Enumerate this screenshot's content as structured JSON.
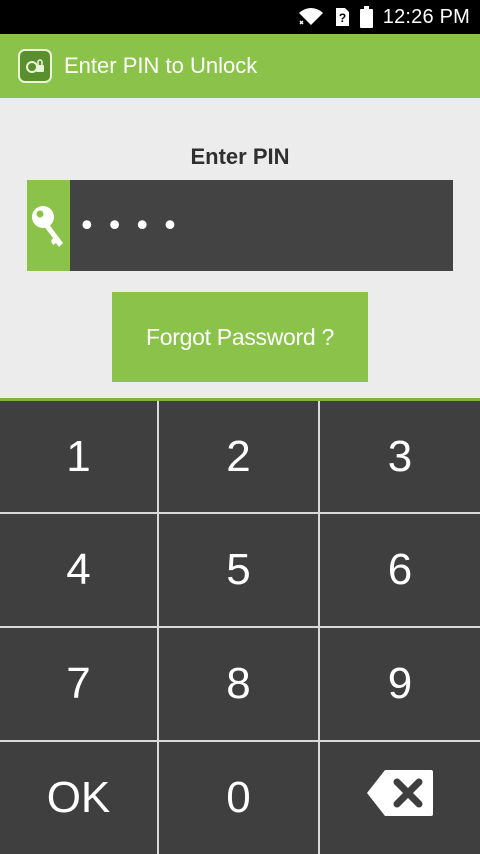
{
  "status_bar": {
    "time": "12:26 PM",
    "icons": [
      "wifi-icon",
      "sim-unknown-icon",
      "battery-icon"
    ],
    "sim_glyph": "?"
  },
  "app_bar": {
    "title": "Enter PIN to Unlock",
    "logo_icon": "app-lock-icon"
  },
  "pin": {
    "label": "Enter PIN",
    "value": "••••",
    "key_icon": "key-icon"
  },
  "forgot_button": {
    "label": "Forgot Password ?"
  },
  "keypad": {
    "keys": [
      "1",
      "2",
      "3",
      "4",
      "5",
      "6",
      "7",
      "8",
      "9",
      "OK",
      "0"
    ],
    "backspace_icon": "backspace-icon"
  },
  "colors": {
    "accent_green": "#8bc34a",
    "dark_gray": "#3f3f3f",
    "background": "#ececec"
  }
}
